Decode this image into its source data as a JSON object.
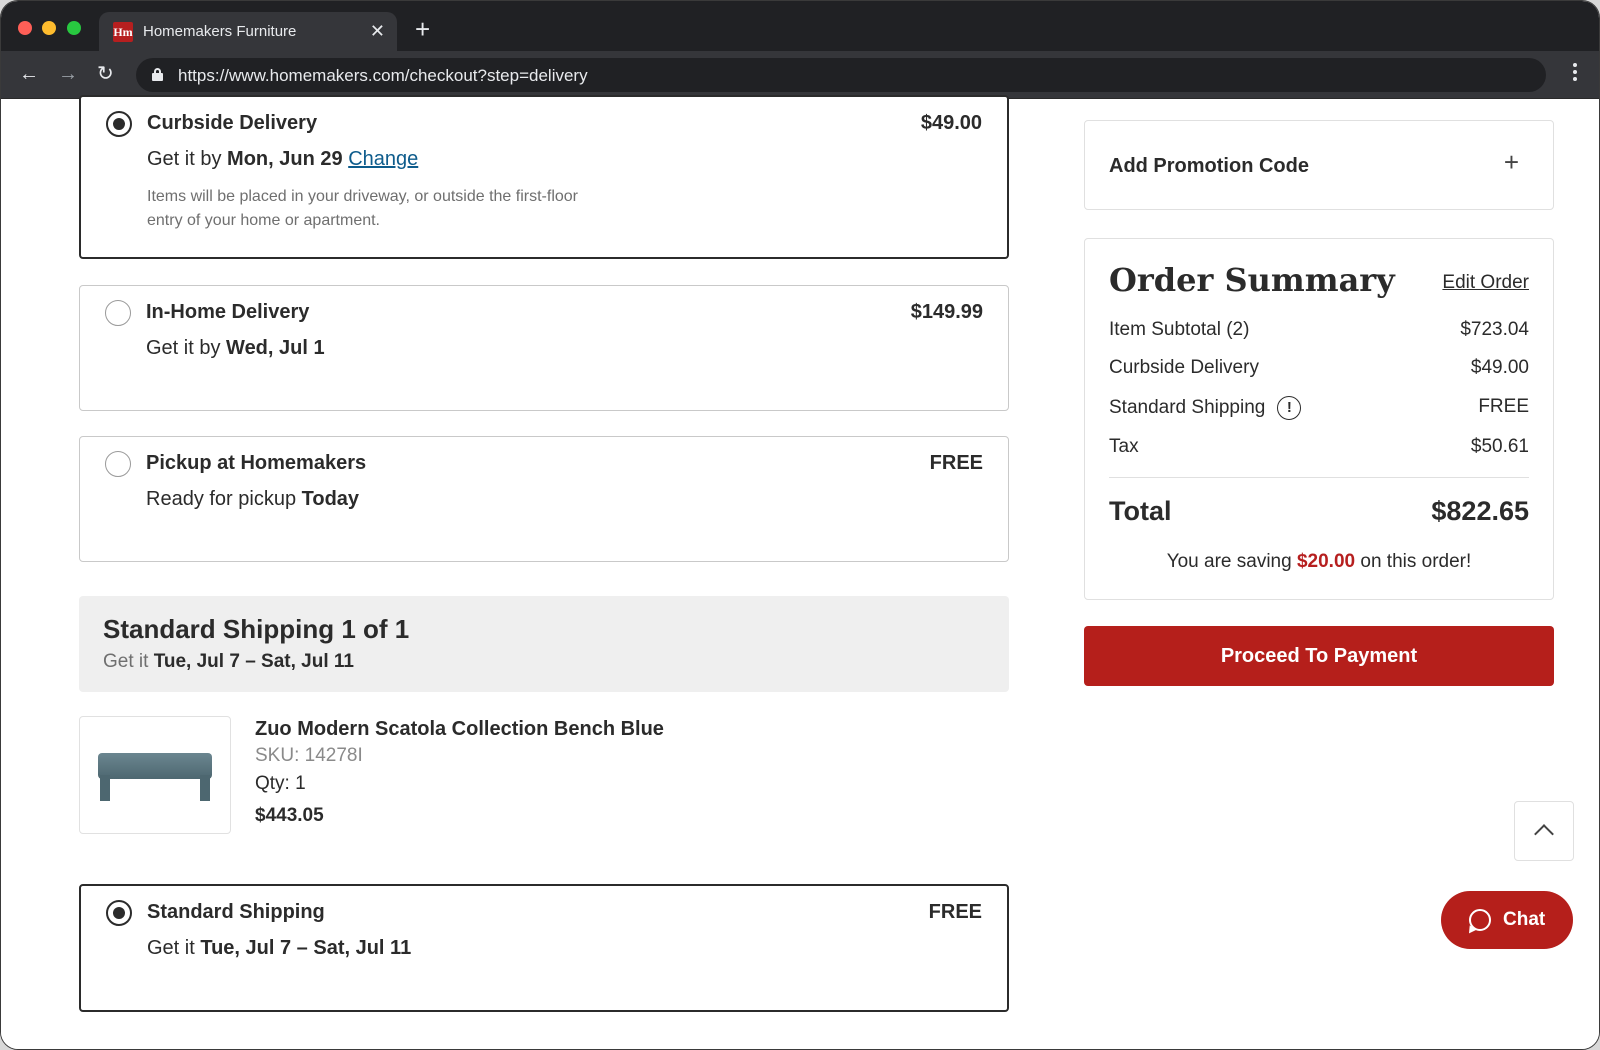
{
  "browser": {
    "tab_title": "Homemakers Furniture",
    "tab_favicon_text": "Hm",
    "url": "https://www.homemakers.com/checkout?step=delivery"
  },
  "delivery_options": [
    {
      "name": "Curbside Delivery",
      "price": "$49.00",
      "line_prefix": "Get it by",
      "line_bold": "Mon, Jun 29",
      "change_label": "Change",
      "description": "Items will be placed in your driveway, or outside the first-floor entry of your home or apartment.",
      "selected": true
    },
    {
      "name": "In-Home Delivery",
      "price": "$149.99",
      "line_prefix": "Get it by",
      "line_bold": "Wed, Jul 1",
      "selected": false
    },
    {
      "name": "Pickup at Homemakers",
      "price": "FREE",
      "line_prefix": "Ready for pickup",
      "line_bold": "Today",
      "selected": false
    }
  ],
  "standard_shipping_section": {
    "title": "Standard Shipping 1 of 1",
    "sub_prefix": "Get it",
    "sub_bold": "Tue, Jul 7 – Sat, Jul 11"
  },
  "product": {
    "name": "Zuo Modern Scatola Collection Bench Blue",
    "sku": "SKU: 14278I",
    "qty": "Qty: 1",
    "price": "$443.05"
  },
  "shipping_option": {
    "name": "Standard Shipping",
    "price": "FREE",
    "line_prefix": "Get it",
    "line_bold": "Tue, Jul 7 – Sat, Jul 11",
    "selected": true
  },
  "promo": {
    "label": "Add Promotion Code",
    "plus": "+"
  },
  "summary": {
    "title": "Order Summary",
    "edit_label": "Edit Order",
    "rows": [
      {
        "label": "Item Subtotal (2)",
        "value": "$723.04"
      },
      {
        "label": "Curbside Delivery",
        "value": "$49.00"
      },
      {
        "label": "Standard Shipping",
        "value": "FREE"
      },
      {
        "label": "Tax",
        "value": "$50.61"
      }
    ],
    "info_glyph": "!",
    "total_label": "Total",
    "total_value": "$822.65",
    "saving_prefix": "You are saving",
    "saving_amount": "$20.00",
    "saving_suffix": "on this order!"
  },
  "proceed_label": "Proceed To Payment",
  "chat_label": "Chat",
  "colors": {
    "brand_red": "#b51f1b",
    "link_blue": "#0e5c8c",
    "text": "#2b2b2b"
  }
}
